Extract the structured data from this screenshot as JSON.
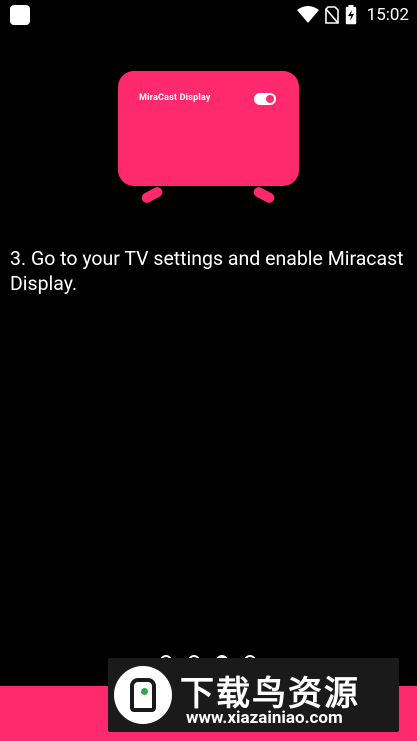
{
  "status_bar": {
    "time": "15:02",
    "icons": [
      "app-notification-icon",
      "wifi-icon",
      "no-sim-icon",
      "battery-charging-icon"
    ]
  },
  "illustration": {
    "tv_label": "MiraCast Display",
    "toggle_state": "on"
  },
  "instruction": {
    "text": "3. Go to your TV settings and enable Miracast Display."
  },
  "pager": {
    "total": 4,
    "current": 3
  },
  "watermark": {
    "title": "下载鸟资源",
    "url": "www.xiazainiao.com"
  },
  "colors": {
    "background": "#000000",
    "accent": "#ff2a6d",
    "text": "#ffffff"
  }
}
